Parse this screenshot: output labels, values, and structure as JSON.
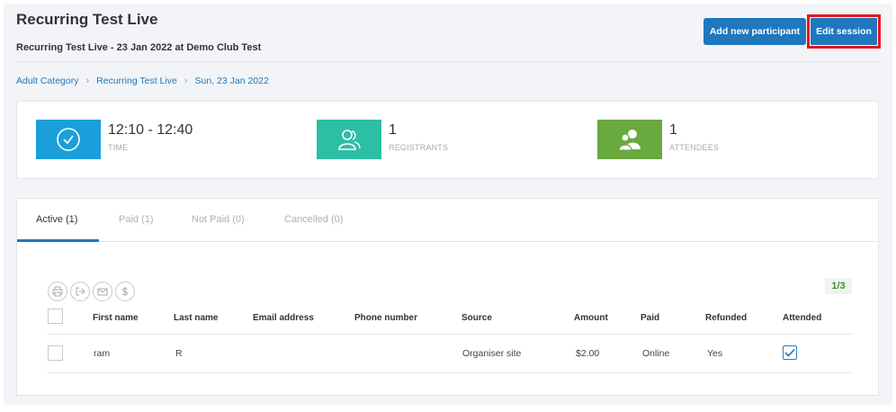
{
  "header": {
    "title": "Recurring Test Live",
    "subtitle": "Recurring Test Live - 23 Jan 2022 at Demo Club Test",
    "add_participant_label": "Add new participant",
    "edit_session_label": "Edit session"
  },
  "breadcrumb": {
    "items": [
      "Adult Category",
      "Recurring Test Live",
      "Sun, 23 Jan 2022"
    ],
    "separator": "›"
  },
  "stats": [
    {
      "value": "12:10 - 12:40",
      "label": "TIME",
      "icon": "clock-icon",
      "color": "#1a9fdb"
    },
    {
      "value": "1",
      "label": "REGISTRANTS",
      "icon": "users-icon",
      "color": "#2dbfa3"
    },
    {
      "value": "1",
      "label": "ATTENDEES",
      "icon": "group-icon",
      "color": "#6aa93e"
    }
  ],
  "tabs": [
    {
      "label": "Active (1)",
      "active": true
    },
    {
      "label": "Paid (1)",
      "active": false
    },
    {
      "label": "Not Paid (0)",
      "active": false
    },
    {
      "label": "Cancelled (0)",
      "active": false
    }
  ],
  "toolbar": {
    "icons": [
      "print-icon",
      "export-icon",
      "email-icon",
      "dollar-icon"
    ],
    "pager": "1/3"
  },
  "table": {
    "columns": [
      "First name",
      "Last name",
      "Email address",
      "Phone number",
      "Source",
      "Amount",
      "Paid",
      "Refunded",
      "Attended"
    ],
    "rows": [
      {
        "first_name": "ram",
        "last_name": "R",
        "email": "",
        "phone": "",
        "source": "Organiser site",
        "amount": "$2.00",
        "paid": "Online",
        "refunded": "Yes",
        "attended": true
      }
    ]
  },
  "colors": {
    "primary": "#1f78be",
    "highlight": "#e8141b",
    "time": "#1a9fdb",
    "registrants": "#2dbfa3",
    "attendees": "#6aa93e"
  }
}
